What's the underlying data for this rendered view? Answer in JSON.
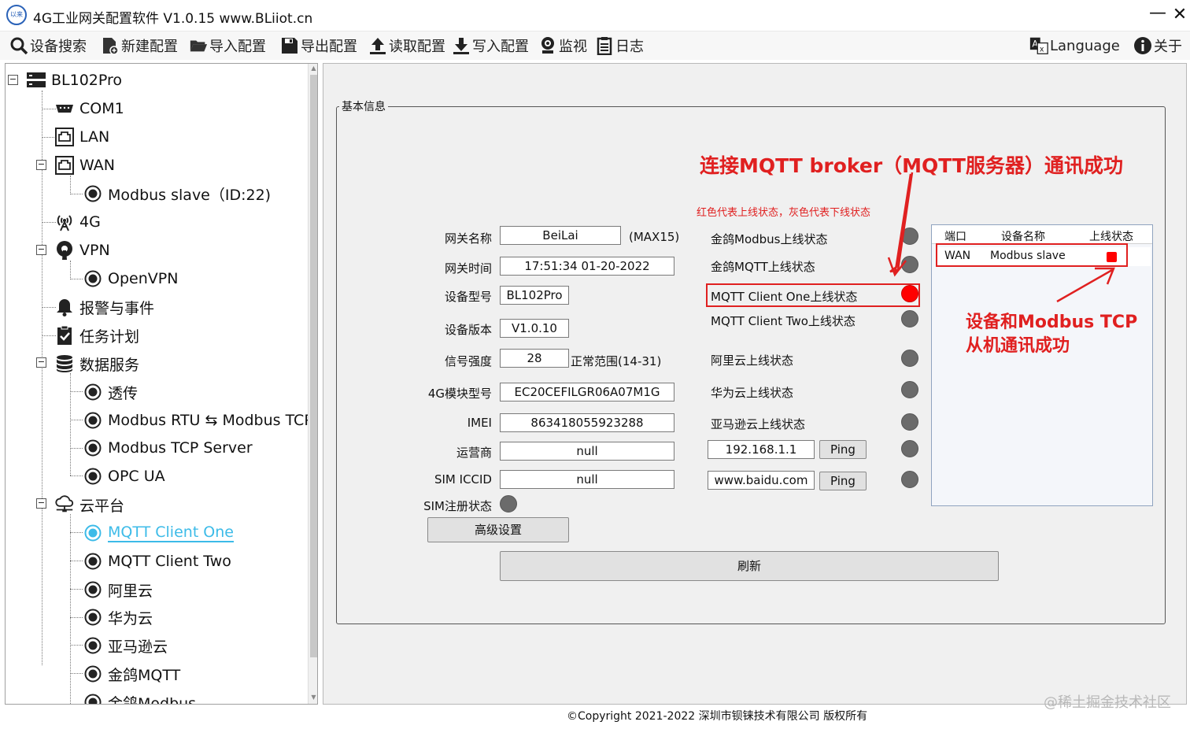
{
  "window": {
    "logo_text": "以来",
    "title": "4G工业网关配置软件 V1.0.15 www.BLiiot.cn",
    "minimize": "—",
    "close": "✕"
  },
  "toolbar": {
    "search": "设备搜索",
    "new_config": "新建配置",
    "import_config": "导入配置",
    "export_config": "导出配置",
    "read_config": "读取配置",
    "write_config": "写入配置",
    "monitor": "监视",
    "log": "日志",
    "language": "Language",
    "about": "关于"
  },
  "tree": {
    "root": "BL102Pro",
    "com1": "COM1",
    "lan": "LAN",
    "wan": "WAN",
    "modbus_slave": "Modbus slave（ID:22)",
    "g4": "4G",
    "vpn": "VPN",
    "openvpn": "OpenVPN",
    "alarm": "报警与事件",
    "task": "任务计划",
    "data_service": "数据服务",
    "passthrough": "透传",
    "rtu_tcp": "Modbus RTU ⇆ Modbus TCP",
    "tcp_server": "Modbus TCP Server",
    "opcua": "OPC UA",
    "cloud": "云平台",
    "mqtt_one": "MQTT Client One",
    "mqtt_two": "MQTT Client Two",
    "aliyun": "阿里云",
    "huawei": "华为云",
    "aws": "亚马逊云",
    "jinge_mqtt": "金鸽MQTT",
    "jinge_modbus": "金鸽Modbus",
    "expand_symbol": "−"
  },
  "info": {
    "group_title": "基本信息",
    "gw_name_label": "网关名称",
    "gw_name": "BeiLai",
    "gw_name_hint": "(MAX15)",
    "gw_time_label": "网关时间",
    "gw_time": "17:51:34 01-20-2022",
    "model_label": "设备型号",
    "model": "BL102Pro",
    "version_label": "设备版本",
    "version": "V1.0.10",
    "signal_label": "信号强度",
    "signal": "28",
    "signal_hint": "正常范围(14-31)",
    "module_label": "4G模块型号",
    "module": "EC20CEFILGR06A07M1G",
    "imei_label": "IMEI",
    "imei": "863418055923288",
    "carrier_label": "运营商",
    "carrier": "null",
    "iccid_label": "SIM ICCID",
    "iccid": "null",
    "sim_status_label": "SIM注册状态",
    "advanced": "高级设置",
    "refresh": "刷新"
  },
  "status": {
    "legend": "红色代表上线状态，灰色代表下线状态",
    "items": [
      {
        "label": "金鸽Modbus上线状态",
        "online": false
      },
      {
        "label": "金鸽MQTT上线状态",
        "online": false
      },
      {
        "label": "MQTT Client One上线状态",
        "online": true
      },
      {
        "label": "MQTT Client Two上线状态",
        "online": false
      },
      {
        "label": "阿里云上线状态",
        "online": false
      },
      {
        "label": "华为云上线状态",
        "online": false
      },
      {
        "label": "亚马逊云上线状态",
        "online": false
      }
    ],
    "ping_ip": "192.168.1.1",
    "ping_host": "www.baidu.com",
    "ping_button": "Ping"
  },
  "port_table": {
    "headers": [
      "端口",
      "设备名称",
      "上线状态"
    ],
    "rows": [
      {
        "port": "WAN",
        "device": "Modbus slave",
        "online": true
      }
    ]
  },
  "annotations": {
    "mqtt_success": "连接MQTT broker（MQTT服务器）通讯成功",
    "modbus_success_line1": "设备和Modbus TCP",
    "modbus_success_line2": "从机通讯成功"
  },
  "footer": "©Copyright 2021-2022 深圳市钡铼技术有限公司 版权所有",
  "watermark": "@稀土掘金技术社区",
  "colors": {
    "online": "#ff0000",
    "offline": "#6b6b6b",
    "annotation": "#e02020",
    "selected": "#3cbbe8"
  }
}
